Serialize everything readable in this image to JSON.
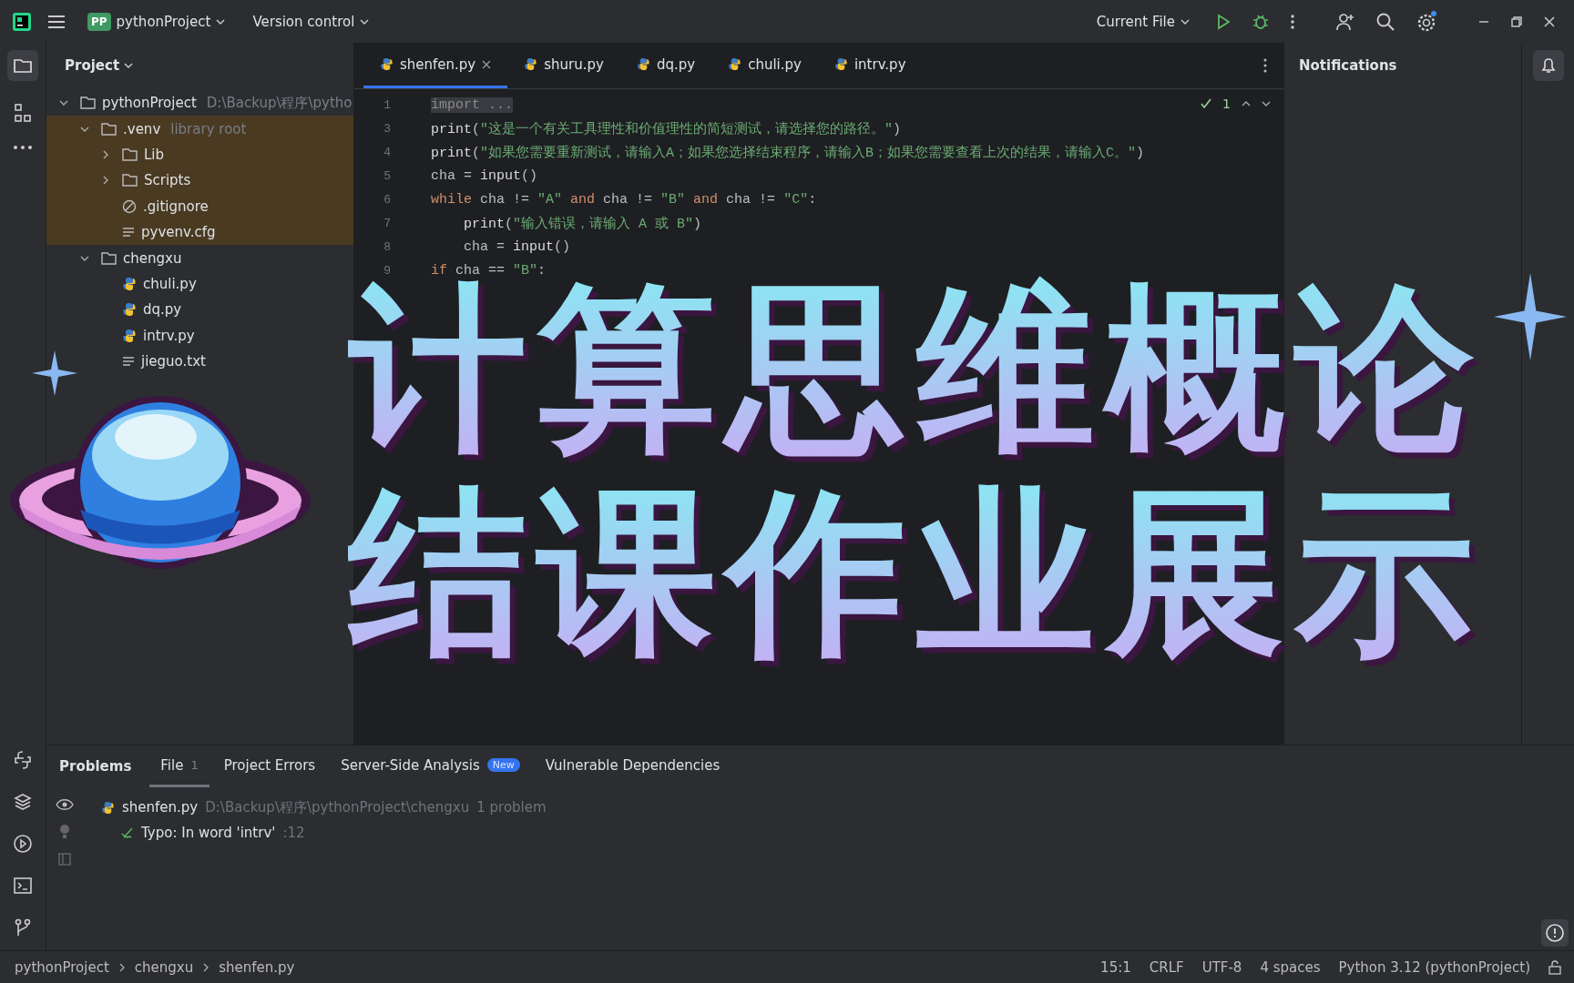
{
  "title_bar": {
    "project_badge": "PP",
    "project": "pythonProject",
    "vcs": "Version control",
    "run_config": "Current File"
  },
  "project_panel": {
    "title": "Project",
    "tree": [
      {
        "name": "pythonProject",
        "kind": "folder",
        "hint": "D:\\Backup\\程序\\pytho",
        "expanded": true,
        "children": [
          {
            "name": ".venv",
            "kind": "folder",
            "hint": "library root",
            "expanded": true,
            "library": true,
            "children": [
              {
                "name": "Lib",
                "kind": "folder",
                "expanded": false
              },
              {
                "name": "Scripts",
                "kind": "folder",
                "expanded": false
              },
              {
                "name": ".gitignore",
                "kind": "ignore"
              },
              {
                "name": "pyvenv.cfg",
                "kind": "text"
              }
            ]
          },
          {
            "name": "chengxu",
            "kind": "folder",
            "expanded": true,
            "children": [
              {
                "name": "chuli.py",
                "kind": "python"
              },
              {
                "name": "dq.py",
                "kind": "python"
              },
              {
                "name": "intrv.py",
                "kind": "python"
              },
              {
                "name": "jieguo.txt",
                "kind": "text"
              }
            ]
          }
        ]
      }
    ]
  },
  "editor_tabs": [
    {
      "label": "shenfen.py",
      "selected": true
    },
    {
      "label": "shuru.py",
      "selected": false
    },
    {
      "label": "dq.py",
      "selected": false
    },
    {
      "label": "chuli.py",
      "selected": false
    },
    {
      "label": "intrv.py",
      "selected": false
    }
  ],
  "inspection_count": "1",
  "code": [
    {
      "n": "1",
      "tokens": [
        {
          "t": "import ...",
          "kind": "fold"
        }
      ]
    },
    {
      "n": "3",
      "tokens": [
        {
          "t": "print",
          "kind": "fn"
        },
        {
          "t": "(",
          "kind": "p"
        },
        {
          "t": "\"这是一个有关工具理性和价值理性的简短测试，请选择您的路径。\"",
          "kind": "str"
        },
        {
          "t": ")",
          "kind": "p"
        }
      ]
    },
    {
      "n": "4",
      "tokens": [
        {
          "t": "print",
          "kind": "fn"
        },
        {
          "t": "(",
          "kind": "p"
        },
        {
          "t": "\"如果您需要重新测试，请输入A；如果您选择结束程序，请输入B；如果您需要查看上次的结果，请输入C。\"",
          "kind": "str"
        },
        {
          "t": ")",
          "kind": "p"
        }
      ]
    },
    {
      "n": "5",
      "tokens": [
        {
          "t": "cha = ",
          "kind": "p"
        },
        {
          "t": "input",
          "kind": "fn"
        },
        {
          "t": "()",
          "kind": "p"
        }
      ]
    },
    {
      "n": "6",
      "tokens": [
        {
          "t": "while",
          "kind": "kw"
        },
        {
          "t": " cha != ",
          "kind": "p"
        },
        {
          "t": "\"A\"",
          "kind": "str"
        },
        {
          "t": " and ",
          "kind": "kw"
        },
        {
          "t": "cha != ",
          "kind": "p"
        },
        {
          "t": "\"B\"",
          "kind": "str"
        },
        {
          "t": " and ",
          "kind": "kw"
        },
        {
          "t": "cha != ",
          "kind": "p"
        },
        {
          "t": "\"C\"",
          "kind": "str"
        },
        {
          "t": ":",
          "kind": "p"
        }
      ]
    },
    {
      "n": "7",
      "tokens": [
        {
          "t": "    print",
          "kind": "fn"
        },
        {
          "t": "(",
          "kind": "p"
        },
        {
          "t": "\"输入错误，请输入 A 或 B\"",
          "kind": "str"
        },
        {
          "t": ")",
          "kind": "p"
        }
      ]
    },
    {
      "n": "8",
      "tokens": [
        {
          "t": "    cha = ",
          "kind": "p"
        },
        {
          "t": "input",
          "kind": "fn"
        },
        {
          "t": "()",
          "kind": "p"
        }
      ]
    },
    {
      "n": "9",
      "tokens": [
        {
          "t": "if",
          "kind": "kw"
        },
        {
          "t": " cha == ",
          "kind": "p"
        },
        {
          "t": "\"B\"",
          "kind": "str"
        },
        {
          "t": ":",
          "kind": "p"
        }
      ]
    }
  ],
  "notifications": {
    "title": "Notifications"
  },
  "overlay": {
    "lines": [
      "计算思维概论",
      "结课作业展示"
    ]
  },
  "problems": {
    "title": "Problems",
    "tabs": [
      {
        "label": "File",
        "count": "1",
        "selected": true
      },
      {
        "label": "Project Errors",
        "selected": false
      },
      {
        "label": "Server-Side Analysis",
        "badge": "New",
        "selected": false
      },
      {
        "label": "Vulnerable Dependencies",
        "selected": false
      }
    ],
    "file": {
      "name": "shenfen.py",
      "path": "D:\\Backup\\程序\\pythonProject\\chengxu",
      "summary": "1 problem"
    },
    "issue": {
      "text": "Typo: In word 'intrv'",
      "line": ":12"
    }
  },
  "status_bar": {
    "breadcrumbs": [
      "pythonProject",
      "chengxu",
      "shenfen.py"
    ],
    "items": [
      "15:1",
      "CRLF",
      "UTF-8",
      "4 spaces",
      "Python 3.12 (pythonProject)"
    ]
  }
}
